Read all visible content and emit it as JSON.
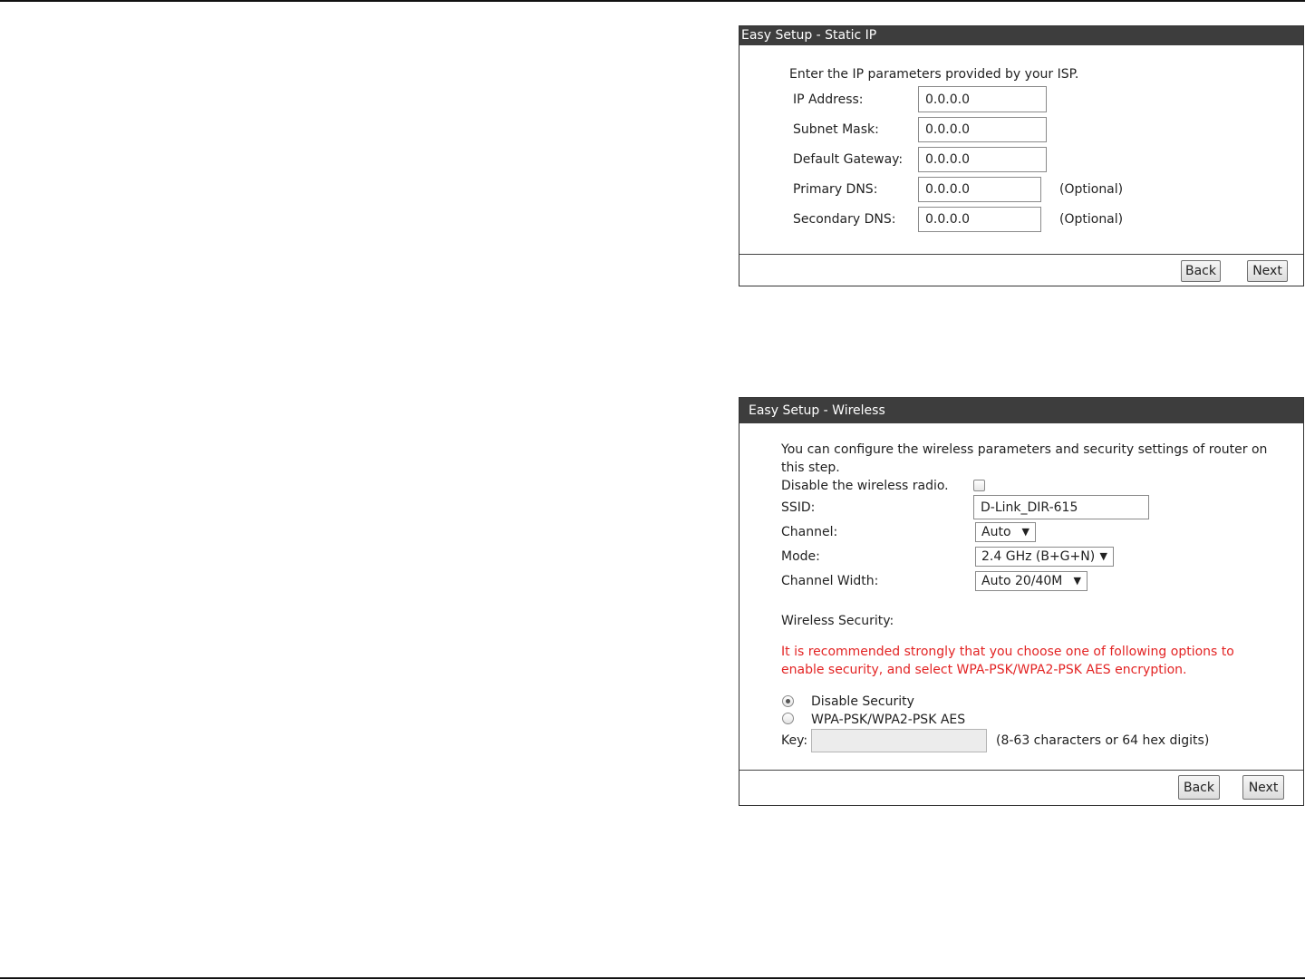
{
  "static_ip": {
    "title": "Easy Setup - Static IP",
    "intro": "Enter the IP parameters provided by your ISP.",
    "fields": [
      {
        "label": "IP Address:",
        "value": "0.0.0.0",
        "note": ""
      },
      {
        "label": "Subnet Mask:",
        "value": "0.0.0.0",
        "note": ""
      },
      {
        "label": "Default Gateway:",
        "value": "0.0.0.0",
        "note": ""
      },
      {
        "label": "Primary DNS:",
        "value": "0.0.0.0",
        "note": "(Optional)"
      },
      {
        "label": "Secondary DNS:",
        "value": "0.0.0.0",
        "note": "(Optional)"
      }
    ],
    "back_label": "Back",
    "next_label": "Next"
  },
  "wireless": {
    "title": "Easy Setup - Wireless",
    "intro_line1": "You can configure the wireless parameters and security settings of router on",
    "intro_line2": "this step.",
    "disable_radio_label": "Disable the wireless radio.",
    "disable_radio_checked": false,
    "ssid_label": "SSID:",
    "ssid_value": "D-Link_DIR-615",
    "channel_label": "Channel:",
    "channel_value": "Auto",
    "mode_label": "Mode:",
    "mode_value": "2.4 GHz (B+G+N)",
    "channel_width_label": "Channel Width:",
    "channel_width_value": "Auto 20/40M",
    "security_heading": "Wireless Security:",
    "warning_line1": "It is recommended strongly that you choose one of following options to",
    "warning_line2": "enable security, and select WPA-PSK/WPA2-PSK AES encryption.",
    "security_options": [
      {
        "label": "Disable Security",
        "selected": true
      },
      {
        "label": "WPA-PSK/WPA2-PSK AES",
        "selected": false
      }
    ],
    "key_label": "Key:",
    "key_value": "",
    "key_hint": "(8-63 characters or 64 hex digits)",
    "back_label": "Back",
    "next_label": "Next"
  },
  "colors": {
    "title_bar": "#3d3d3d",
    "warning_text": "#e32424"
  },
  "icons": {
    "select_caret": "▼"
  }
}
